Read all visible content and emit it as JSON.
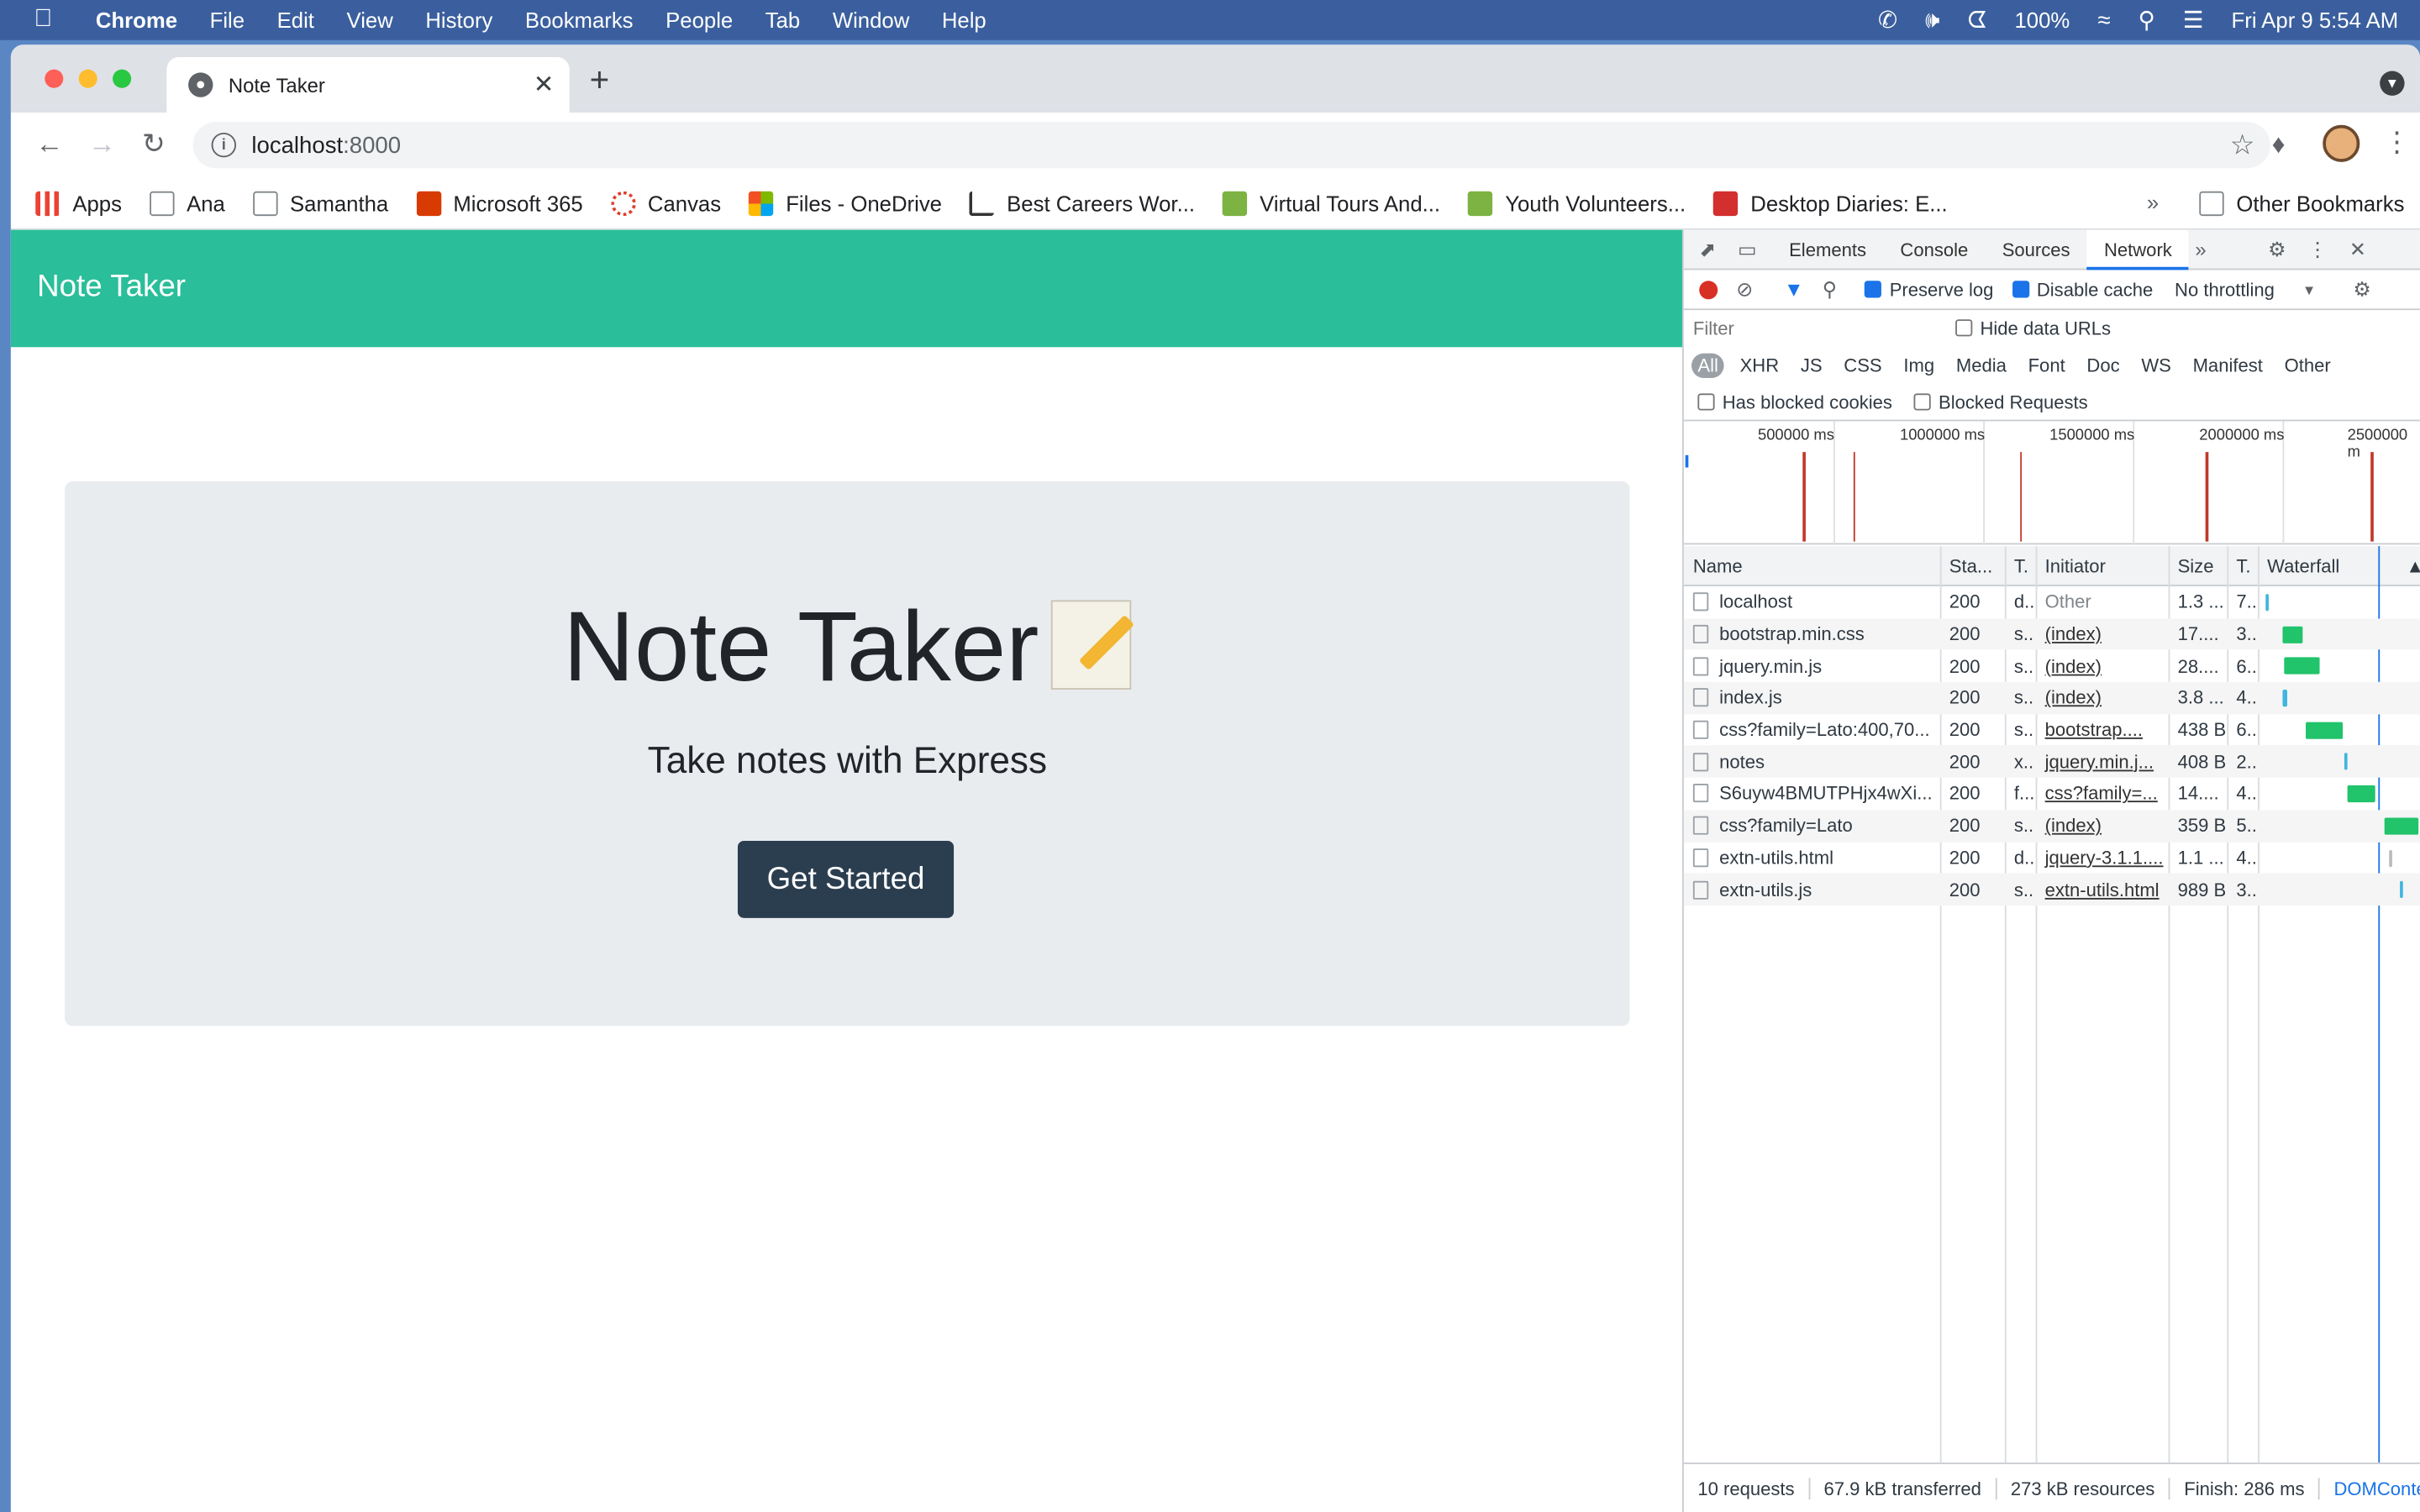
{
  "menubar": {
    "app": "Chrome",
    "items": [
      "File",
      "Edit",
      "View",
      "History",
      "Bookmarks",
      "People",
      "Tab",
      "Window",
      "Help"
    ],
    "battery": "100%",
    "datetime": "Fri Apr 9  5:54 AM"
  },
  "tab": {
    "title": "Note Taker"
  },
  "omnibox": {
    "host": "localhost",
    "port": ":8000"
  },
  "bookmarks": {
    "items": [
      {
        "label": "Apps",
        "color": "#ea4335"
      },
      {
        "label": "Ana",
        "color": "#80868b"
      },
      {
        "label": "Samantha",
        "color": "#80868b"
      },
      {
        "label": "Microsoft 365",
        "color": "#d83b01"
      },
      {
        "label": "Canvas",
        "color": "#e13f2b"
      },
      {
        "label": "Files - OneDrive",
        "color": "#0078d4"
      },
      {
        "label": "Best Careers Wor...",
        "color": "#333333"
      },
      {
        "label": "Virtual Tours And...",
        "color": "#7cb342"
      },
      {
        "label": "Youth Volunteers...",
        "color": "#7cb342"
      },
      {
        "label": "Desktop Diaries: E...",
        "color": "#d32f2f"
      }
    ],
    "more": "»",
    "other": "Other Bookmarks"
  },
  "page": {
    "brand": "Note Taker",
    "heading": "Note Taker",
    "lead": "Take notes with Express",
    "cta": "Get Started",
    "accent": "#2abe9a"
  },
  "devtools": {
    "tabs": [
      "Elements",
      "Console",
      "Sources",
      "Network"
    ],
    "more_tabs": "»",
    "preserve_log": "Preserve log",
    "disable_cache": "Disable cache",
    "throttling": "No throttling",
    "filter_placeholder": "Filter",
    "hide_data_urls": "Hide data URLs",
    "types": [
      "All",
      "XHR",
      "JS",
      "CSS",
      "Img",
      "Media",
      "Font",
      "Doc",
      "WS",
      "Manifest",
      "Other"
    ],
    "has_blocked_cookies": "Has blocked cookies",
    "blocked_requests": "Blocked Requests",
    "overview_labels": [
      "500000 ms",
      "1000000 ms",
      "1500000 ms",
      "2000000 ms",
      "2500000 m"
    ],
    "columns": [
      "Name",
      "Sta...",
      "T.",
      "Initiator",
      "Size",
      "T.",
      "Waterfall"
    ],
    "requests": [
      {
        "name": "localhost",
        "status": "200",
        "type": "d..",
        "initiator": "Other",
        "initiator_link": false,
        "size": "1.3 ...",
        "time": "7..",
        "wf_color": "#3fb5e0",
        "wf_start": 0.01,
        "wf_len": 0.01
      },
      {
        "name": "bootstrap.min.css",
        "status": "200",
        "type": "s..",
        "initiator": "(index)",
        "initiator_link": true,
        "size": "17....",
        "time": "3..",
        "wf_color": "#21c36b",
        "wf_start": 0.12,
        "wf_len": 0.13
      },
      {
        "name": "jquery.min.js",
        "status": "200",
        "type": "s..",
        "initiator": "(index)",
        "initiator_link": true,
        "size": "28....",
        "time": "6..",
        "wf_color": "#21c36b",
        "wf_start": 0.13,
        "wf_len": 0.23
      },
      {
        "name": "index.js",
        "status": "200",
        "type": "s..",
        "initiator": "(index)",
        "initiator_link": true,
        "size": "3.8 ...",
        "time": "4..",
        "wf_color": "#3fb5e0",
        "wf_start": 0.12,
        "wf_len": 0.03
      },
      {
        "name": "css?family=Lato:400,70...",
        "status": "200",
        "type": "s..",
        "initiator": "bootstrap....",
        "initiator_link": true,
        "size": "438 B",
        "time": "6..",
        "wf_color": "#21c36b",
        "wf_start": 0.27,
        "wf_len": 0.24
      },
      {
        "name": "notes",
        "status": "200",
        "type": "x..",
        "initiator": "jquery.min.j...",
        "initiator_link": true,
        "size": "408 B",
        "time": "2..",
        "wf_color": "#3fb5e0",
        "wf_start": 0.52,
        "wf_len": 0.02
      },
      {
        "name": "S6uyw4BMUTPHjx4wXi...",
        "status": "200",
        "type": "f...",
        "initiator": "css?family=...",
        "initiator_link": true,
        "size": "14....",
        "time": "4..",
        "wf_color": "#21c36b",
        "wf_start": 0.54,
        "wf_len": 0.18
      },
      {
        "name": "css?family=Lato",
        "status": "200",
        "type": "s..",
        "initiator": "(index)",
        "initiator_link": true,
        "size": "359 B",
        "time": "5..",
        "wf_color": "#21c36b",
        "wf_start": 0.78,
        "wf_len": 0.22
      },
      {
        "name": "extn-utils.html",
        "status": "200",
        "type": "d..",
        "initiator": "jquery-3.1.1....",
        "initiator_link": true,
        "size": "1.1 ...",
        "time": "4..",
        "wf_color": "#bbbbbb",
        "wf_start": 0.81,
        "wf_len": 0.01
      },
      {
        "name": "extn-utils.js",
        "status": "200",
        "type": "s..",
        "initiator": "extn-utils.html",
        "initiator_link": true,
        "size": "989 B",
        "time": "3..",
        "wf_color": "#3fb5e0",
        "wf_start": 0.88,
        "wf_len": 0.02
      }
    ],
    "summary": [
      "10 requests",
      "67.9 kB transferred",
      "273 kB resources",
      "Finish: 286 ms",
      "DOMConter"
    ]
  }
}
